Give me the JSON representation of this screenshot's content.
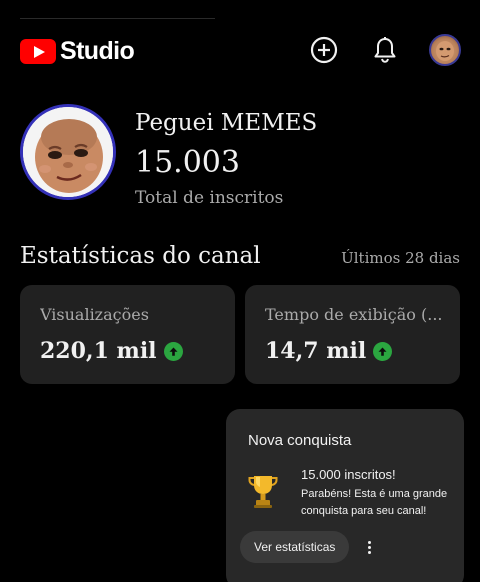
{
  "app": {
    "logo_text": "Studio"
  },
  "header": {
    "icons": [
      "youtube-logo-icon",
      "create-icon",
      "notifications-bell-icon",
      "account-avatar"
    ]
  },
  "channel": {
    "name": "Peguei MEMES",
    "subscribers": "15.003",
    "subscribers_label": "Total de inscritos"
  },
  "stats": {
    "title": "Estatísticas do canal",
    "period": "Últimos 28 dias",
    "cards": [
      {
        "label": "Visualizações",
        "value": "220,1 mil",
        "trend": "up"
      },
      {
        "label": "Tempo de exibição (...",
        "value": "14,7 mil",
        "trend": "up"
      }
    ]
  },
  "achievement": {
    "heading": "Nova conquista",
    "title": "15.000 inscritos!",
    "description": "Parabéns! Esta é uma grande conquista para seu canal!",
    "button_label": "Ver estatísticas",
    "icon": "trophy-icon"
  },
  "colors": {
    "background": "#000000",
    "card": "#212121",
    "brand_red": "#ff0000",
    "trend_green": "#2ba640",
    "avatar_ring": "#3431b8"
  }
}
